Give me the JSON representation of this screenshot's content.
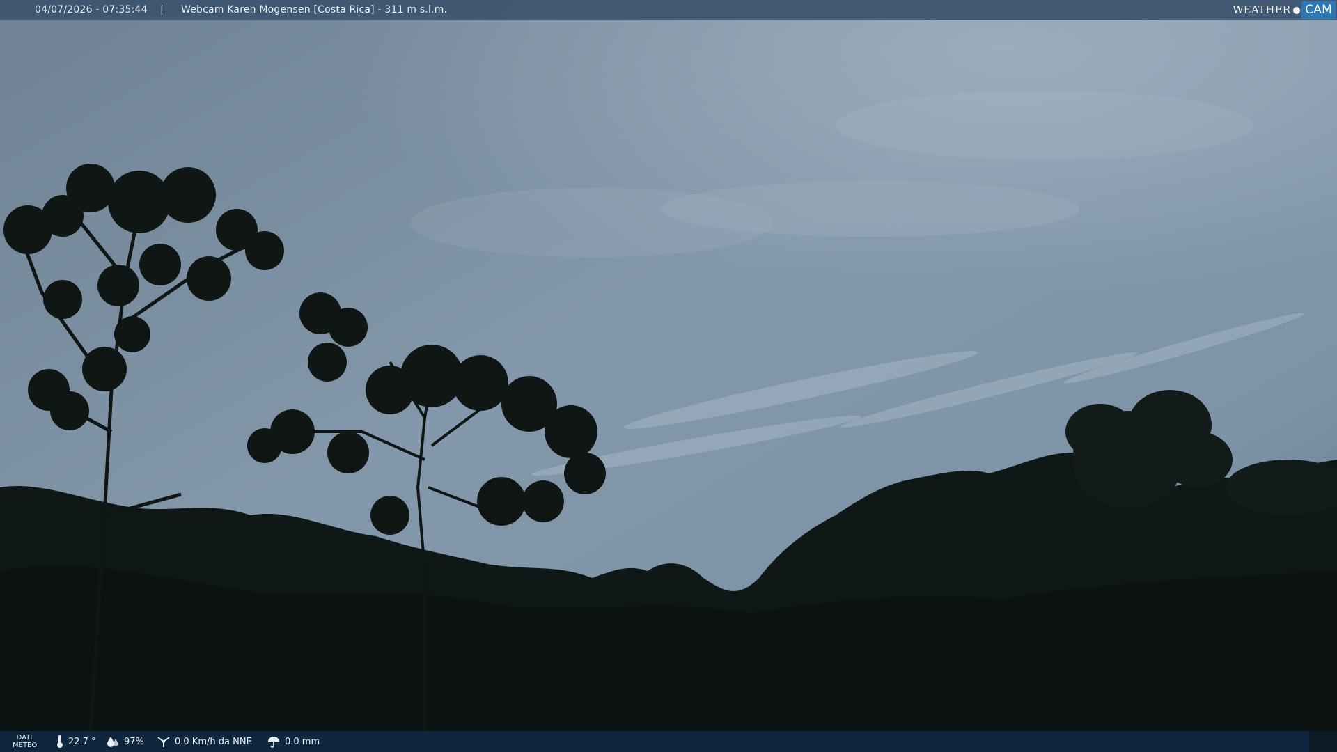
{
  "header": {
    "datetime": "04/07/2026 - 07:35:44",
    "separator": "|",
    "title": "Webcam Karen Mogensen [Costa Rica]  - 311 m s.l.m."
  },
  "logo": {
    "weather": "WEATHER",
    "cam": "CAM"
  },
  "footer": {
    "label_line1": "DATI",
    "label_line2": "METEO",
    "temperature": "22.7 °",
    "humidity": "97%",
    "wind": "0.0 Km/h da NNE",
    "rain": "0.0 mm"
  },
  "icons": [
    "thermometer-icon",
    "humidity-icon",
    "wind-icon",
    "rain-icon"
  ],
  "colors": {
    "sky_light": "#8fa4b4",
    "sky_dark": "#5e7488",
    "foliage": "#0e1614",
    "topbar": "#3c546e",
    "bottombar": "#102842",
    "logo_accent": "#2a78b8"
  }
}
